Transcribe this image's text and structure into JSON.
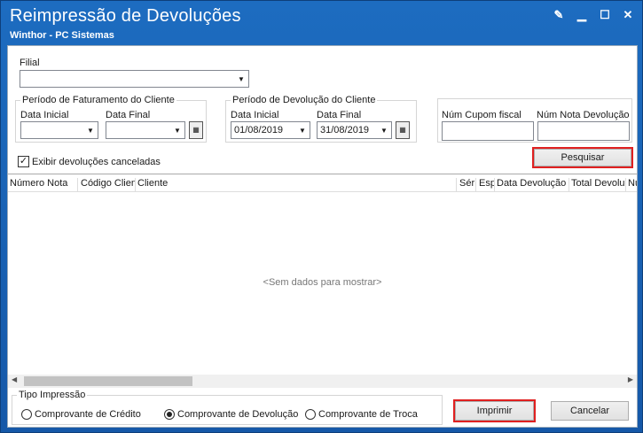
{
  "window": {
    "title": "Reimpressão de Devoluções",
    "subtitle": "Winthor - PC Sistemas"
  },
  "filial": {
    "label": "Filial",
    "value": ""
  },
  "faturamento": {
    "title": "Período de Faturamento do Cliente",
    "data_inicial_label": "Data Inicial",
    "data_inicial": "",
    "data_final_label": "Data Final",
    "data_final": ""
  },
  "devolucao": {
    "title": "Período de Devolução do Cliente",
    "data_inicial_label": "Data Inicial",
    "data_inicial": "01/08/2019",
    "data_final_label": "Data Final",
    "data_final": "31/08/2019"
  },
  "cupom": {
    "label": "Núm Cupom fiscal",
    "value": ""
  },
  "nota_devolucao": {
    "label": "Núm Nota Devolução",
    "value": ""
  },
  "pesquisar_label": "Pesquisar",
  "exibir_canceladas": {
    "label": "Exibir devoluções canceladas",
    "checked": true
  },
  "grid": {
    "columns": [
      "Número Nota",
      "Código Clien",
      "Cliente",
      "Sér",
      "Esp",
      "Data Devolução",
      "Total Devolu",
      "Nu"
    ],
    "empty_text": "<Sem dados para mostrar>"
  },
  "tipo_impressao": {
    "title": "Tipo Impressão",
    "options": [
      "Comprovante de Crédito",
      "Comprovante de Devolução",
      "Comprovante de Troca"
    ],
    "selected": "Comprovante de Devolução"
  },
  "imprimir_label": "Imprimir",
  "cancelar_label": "Cancelar",
  "icons": {
    "calendar": "calendar-icon",
    "dropdown": "chevron-down-icon"
  }
}
